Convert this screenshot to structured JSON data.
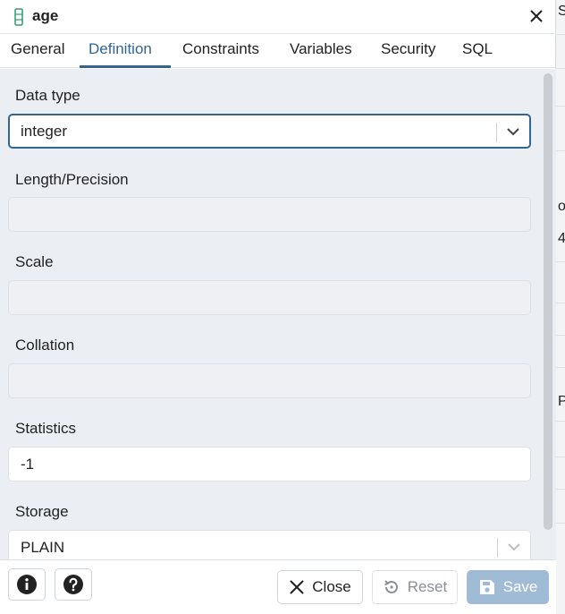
{
  "dialog": {
    "title": "age",
    "tabs": [
      {
        "label": "General"
      },
      {
        "label": "Definition"
      },
      {
        "label": "Constraints"
      },
      {
        "label": "Variables"
      },
      {
        "label": "Security"
      },
      {
        "label": "SQL"
      }
    ],
    "active_tab": "Definition"
  },
  "fields": {
    "data_type": {
      "label": "Data type",
      "value": "integer"
    },
    "length": {
      "label": "Length/Precision",
      "value": ""
    },
    "scale": {
      "label": "Scale",
      "value": ""
    },
    "collation": {
      "label": "Collation",
      "value": ""
    },
    "statistics": {
      "label": "Statistics",
      "value": "-1"
    },
    "storage": {
      "label": "Storage",
      "value": "PLAIN"
    }
  },
  "footer": {
    "close_label": "Close",
    "reset_label": "Reset",
    "save_label": "Save"
  },
  "background_fragments": [
    "S",
    "or",
    "4",
    "Pa"
  ],
  "colors": {
    "accent": "#326690",
    "save_button": "#9fbbd5",
    "content_bg": "#ebeef3"
  },
  "icons": [
    "column-icon",
    "close-icon",
    "chevron-down-icon",
    "info-icon",
    "help-icon",
    "reset-icon",
    "save-icon"
  ]
}
